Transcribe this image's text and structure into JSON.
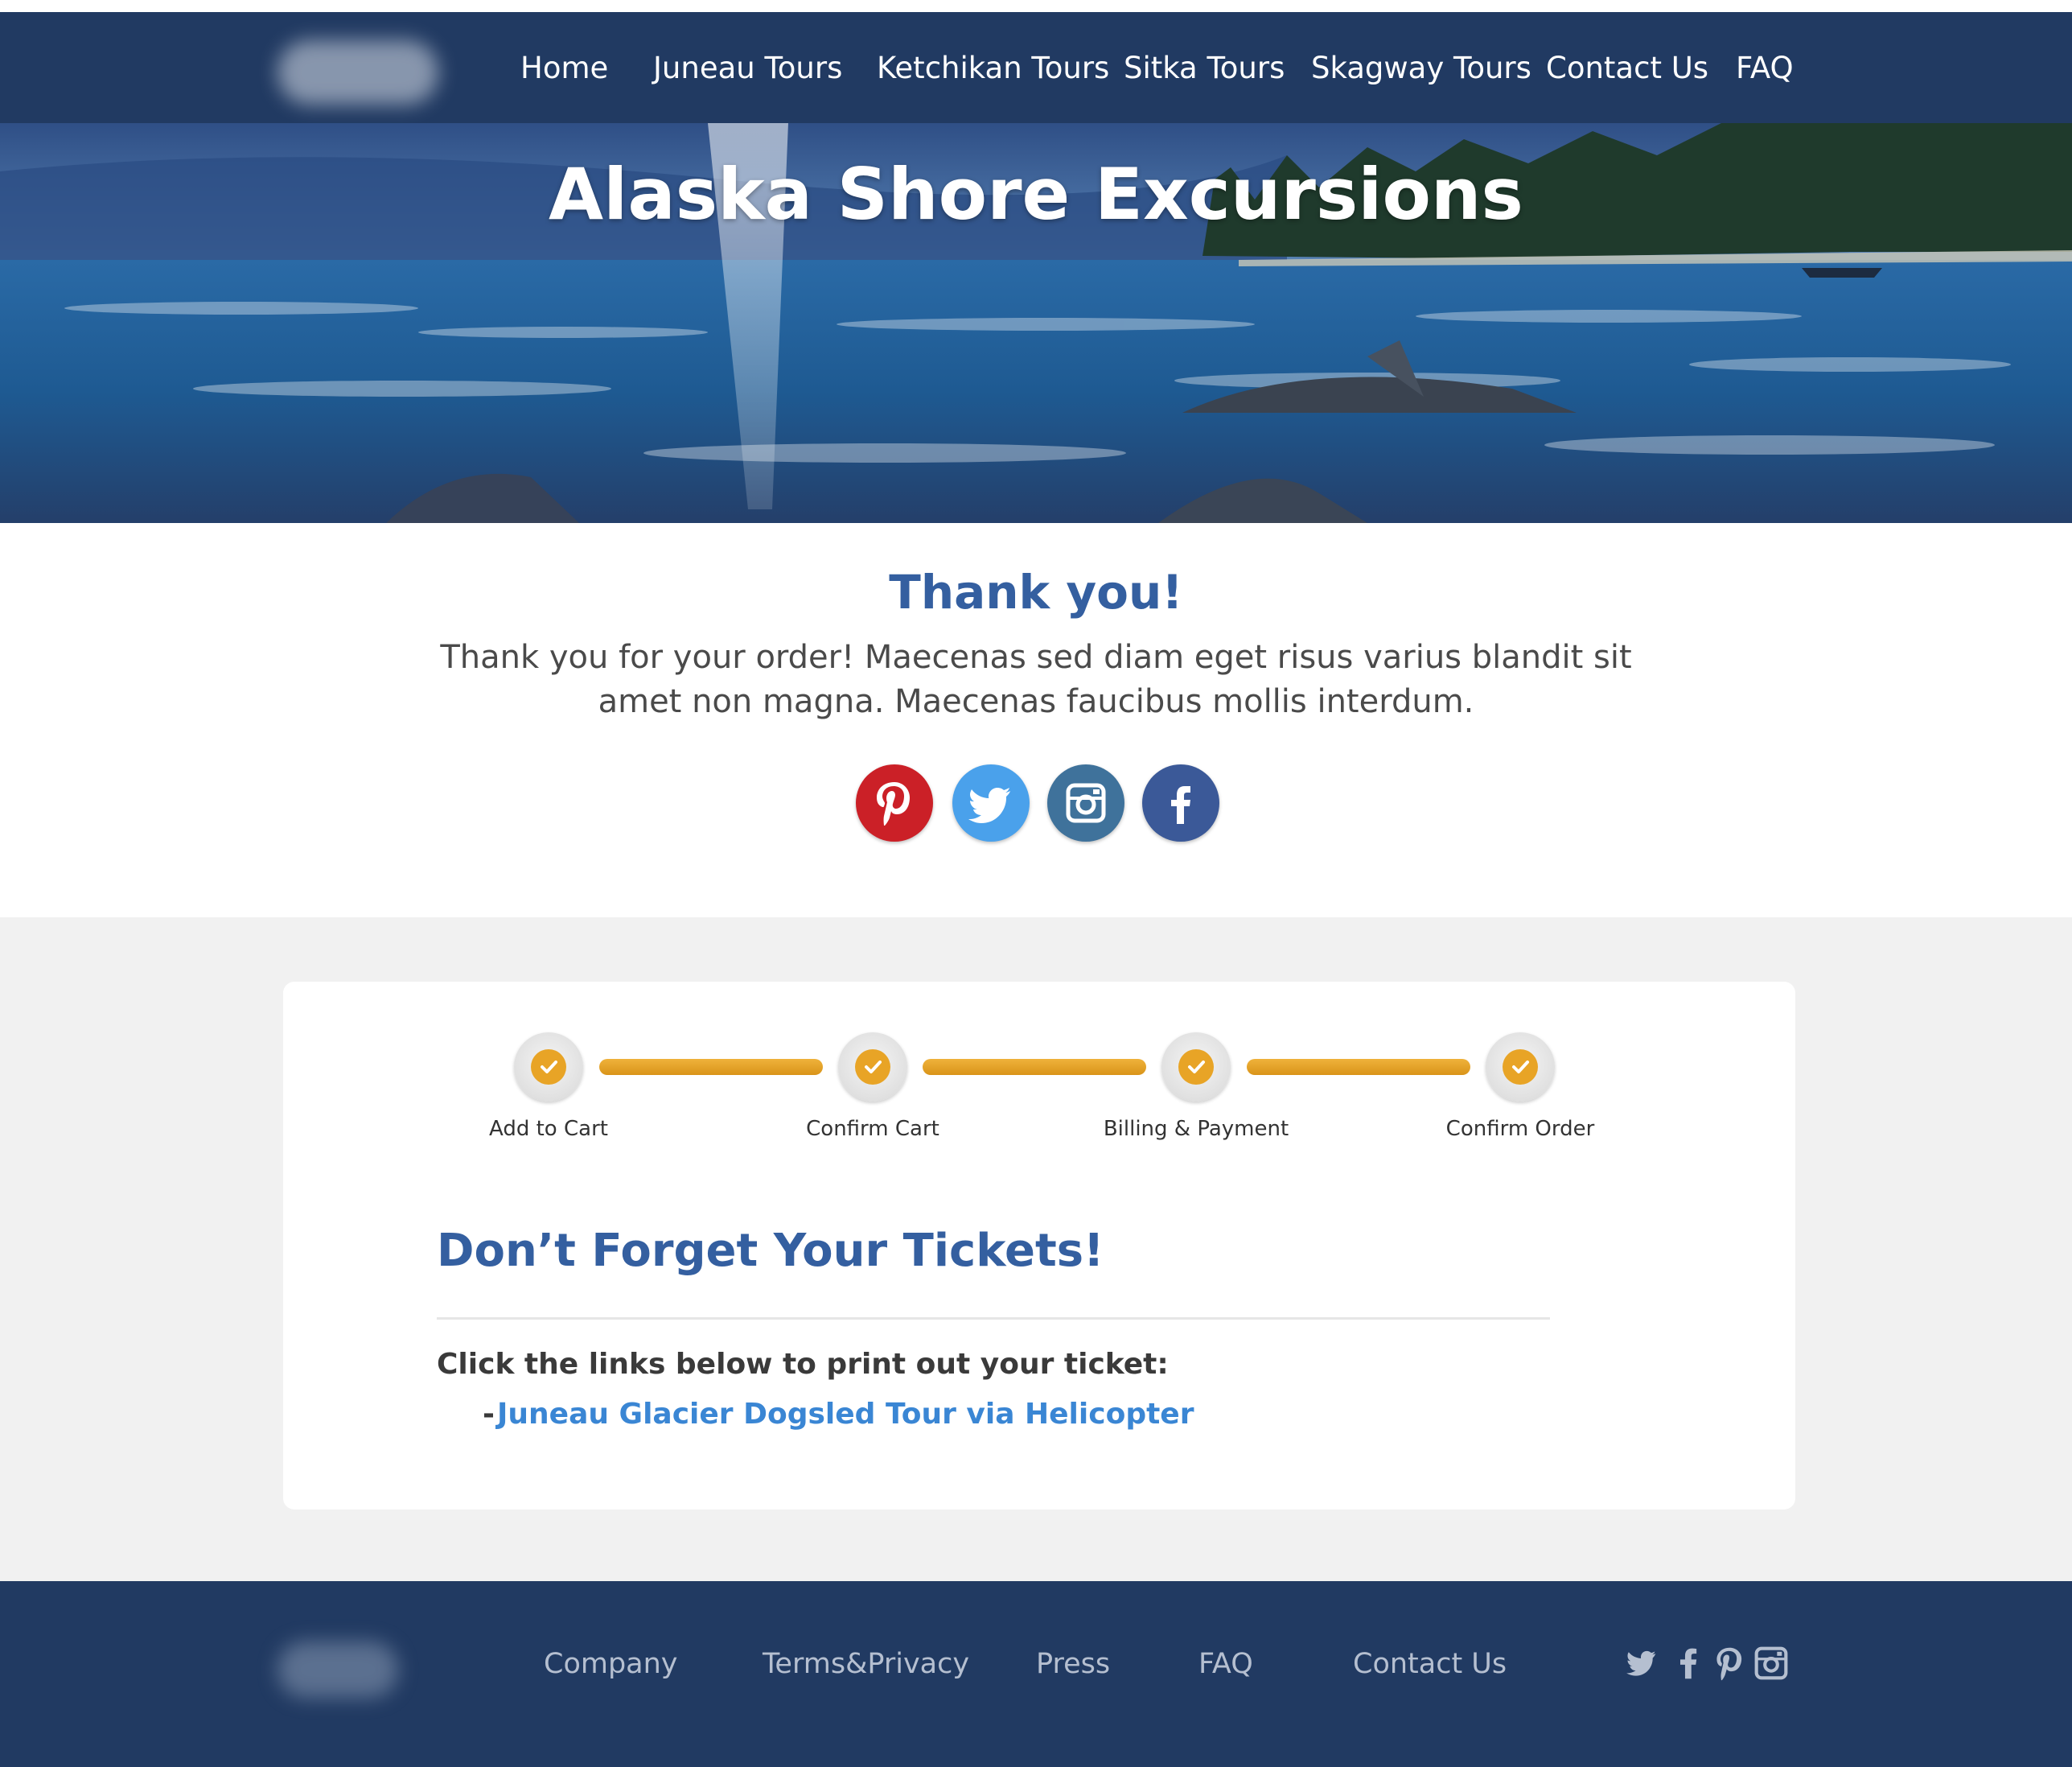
{
  "nav": {
    "items": [
      {
        "label": "Home"
      },
      {
        "label": "Juneau Tours"
      },
      {
        "label": "Ketchikan Tours"
      },
      {
        "label": "Sitka Tours"
      },
      {
        "label": "Skagway Tours"
      },
      {
        "label": "Contact Us"
      },
      {
        "label": "FAQ"
      }
    ]
  },
  "hero": {
    "title": "Alaska Shore Excursions"
  },
  "thanks": {
    "title": "Thank you!",
    "text": "Thank you for your order! Maecenas sed diam eget risus varius blandit sit amet non magna. Maecenas faucibus mollis interdum."
  },
  "social": {
    "icons": [
      "pinterest-icon",
      "twitter-icon",
      "instagram-icon",
      "facebook-icon"
    ],
    "colors": {
      "pinterest": "#cb2027",
      "twitter": "#4aa1eb",
      "instagram": "#3f729b",
      "facebook": "#3b5998"
    }
  },
  "progress": {
    "steps": [
      {
        "label": "Add to Cart",
        "completed": true
      },
      {
        "label": "Confirm Cart",
        "completed": true
      },
      {
        "label": "Billing & Payment",
        "completed": true
      },
      {
        "label": "Confirm Order",
        "completed": true
      }
    ],
    "color": "#e8a426"
  },
  "tickets": {
    "title": "Don’t Forget Your Tickets!",
    "instruction": "Click the links below to print out your ticket:",
    "bullet": "-",
    "links": [
      {
        "label": "Juneau Glacier Dogsled Tour via Helicopter"
      }
    ]
  },
  "footer": {
    "links": [
      {
        "label": "Company"
      },
      {
        "label": "Terms&Privacy"
      },
      {
        "label": "Press"
      },
      {
        "label": "FAQ"
      },
      {
        "label": "Contact Us"
      }
    ],
    "icons": [
      "twitter-icon",
      "facebook-icon",
      "pinterest-icon",
      "instagram-icon"
    ]
  },
  "colors": {
    "header_bg": "#213a62",
    "accent_blue": "#345fa0",
    "link_blue": "#3a86d4",
    "grey_bg": "#f1f1f1"
  }
}
